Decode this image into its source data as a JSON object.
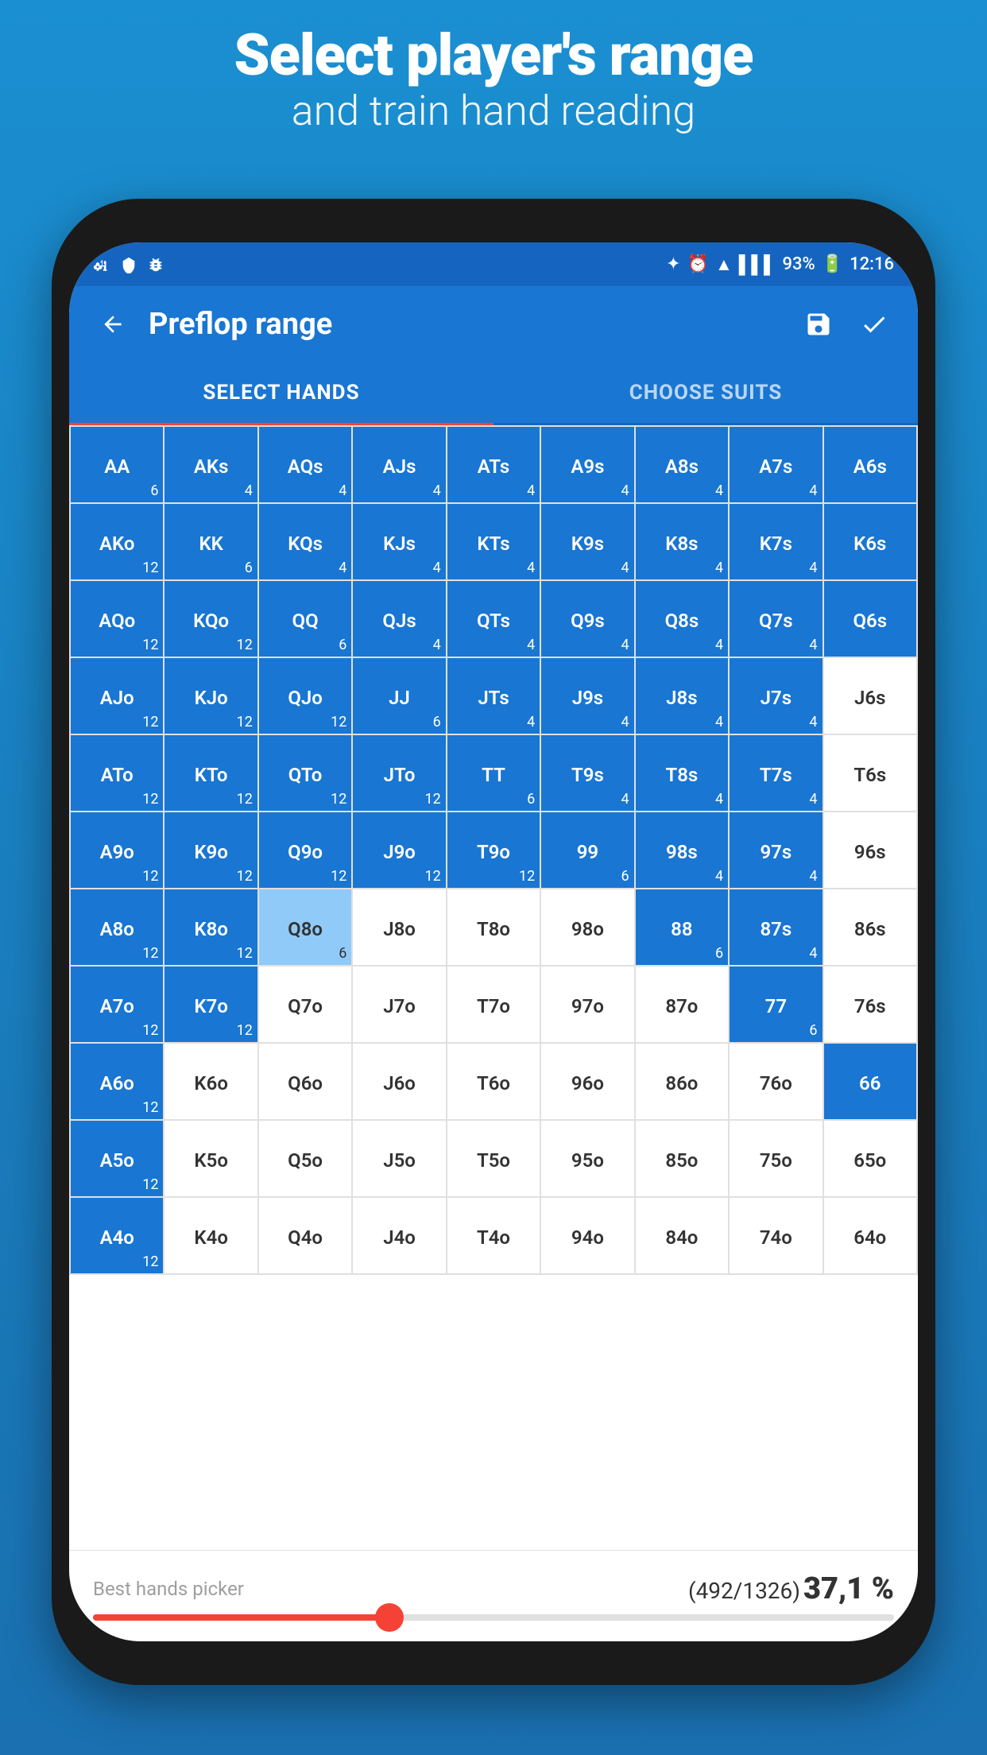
{
  "header": {
    "title": "Select player's range",
    "subtitle": "and train hand reading"
  },
  "status_bar": {
    "battery": "93%",
    "time": "12:16",
    "icons_left": [
      "usb",
      "under-armour",
      "bug"
    ],
    "icons_right": [
      "bluetooth",
      "alarm",
      "wifi",
      "signal",
      "battery",
      "time"
    ]
  },
  "app_bar": {
    "title": "Preflop range",
    "back_label": "←",
    "save_label": "💾",
    "check_label": "✓"
  },
  "tabs": [
    {
      "id": "select-hands",
      "label": "SELECT HANDS",
      "active": true
    },
    {
      "id": "choose-suits",
      "label": "CHOOSE SUITS",
      "active": false
    }
  ],
  "grid": {
    "rows": [
      [
        {
          "name": "AA",
          "count": "6",
          "style": "blue"
        },
        {
          "name": "AKs",
          "count": "4",
          "style": "blue"
        },
        {
          "name": "AQs",
          "count": "4",
          "style": "blue"
        },
        {
          "name": "AJs",
          "count": "4",
          "style": "blue"
        },
        {
          "name": "ATs",
          "count": "4",
          "style": "blue"
        },
        {
          "name": "A9s",
          "count": "4",
          "style": "blue"
        },
        {
          "name": "A8s",
          "count": "4",
          "style": "blue"
        },
        {
          "name": "A7s",
          "count": "4",
          "style": "blue"
        },
        {
          "name": "A6s",
          "count": "",
          "style": "blue"
        }
      ],
      [
        {
          "name": "AKo",
          "count": "12",
          "style": "blue"
        },
        {
          "name": "KK",
          "count": "6",
          "style": "blue"
        },
        {
          "name": "KQs",
          "count": "4",
          "style": "blue"
        },
        {
          "name": "KJs",
          "count": "4",
          "style": "blue"
        },
        {
          "name": "KTs",
          "count": "4",
          "style": "blue"
        },
        {
          "name": "K9s",
          "count": "4",
          "style": "blue"
        },
        {
          "name": "K8s",
          "count": "4",
          "style": "blue"
        },
        {
          "name": "K7s",
          "count": "4",
          "style": "blue"
        },
        {
          "name": "K6s",
          "count": "",
          "style": "blue"
        }
      ],
      [
        {
          "name": "AQo",
          "count": "12",
          "style": "blue"
        },
        {
          "name": "KQo",
          "count": "12",
          "style": "blue"
        },
        {
          "name": "QQ",
          "count": "6",
          "style": "blue"
        },
        {
          "name": "QJs",
          "count": "4",
          "style": "blue"
        },
        {
          "name": "QTs",
          "count": "4",
          "style": "blue"
        },
        {
          "name": "Q9s",
          "count": "4",
          "style": "blue"
        },
        {
          "name": "Q8s",
          "count": "4",
          "style": "blue"
        },
        {
          "name": "Q7s",
          "count": "4",
          "style": "blue"
        },
        {
          "name": "Q6s",
          "count": "",
          "style": "blue"
        }
      ],
      [
        {
          "name": "AJo",
          "count": "12",
          "style": "blue"
        },
        {
          "name": "KJo",
          "count": "12",
          "style": "blue"
        },
        {
          "name": "QJo",
          "count": "12",
          "style": "blue"
        },
        {
          "name": "JJ",
          "count": "6",
          "style": "blue"
        },
        {
          "name": "JTs",
          "count": "4",
          "style": "blue"
        },
        {
          "name": "J9s",
          "count": "4",
          "style": "blue"
        },
        {
          "name": "J8s",
          "count": "4",
          "style": "blue"
        },
        {
          "name": "J7s",
          "count": "4",
          "style": "blue"
        },
        {
          "name": "J6s",
          "count": "",
          "style": "white"
        }
      ],
      [
        {
          "name": "ATo",
          "count": "12",
          "style": "blue"
        },
        {
          "name": "KTo",
          "count": "12",
          "style": "blue"
        },
        {
          "name": "QTo",
          "count": "12",
          "style": "blue"
        },
        {
          "name": "JTo",
          "count": "12",
          "style": "blue"
        },
        {
          "name": "TT",
          "count": "6",
          "style": "blue"
        },
        {
          "name": "T9s",
          "count": "4",
          "style": "blue"
        },
        {
          "name": "T8s",
          "count": "4",
          "style": "blue"
        },
        {
          "name": "T7s",
          "count": "4",
          "style": "blue"
        },
        {
          "name": "T6s",
          "count": "",
          "style": "white"
        }
      ],
      [
        {
          "name": "A9o",
          "count": "12",
          "style": "blue"
        },
        {
          "name": "K9o",
          "count": "12",
          "style": "blue"
        },
        {
          "name": "Q9o",
          "count": "12",
          "style": "blue"
        },
        {
          "name": "J9o",
          "count": "12",
          "style": "blue"
        },
        {
          "name": "T9o",
          "count": "12",
          "style": "blue"
        },
        {
          "name": "99",
          "count": "6",
          "style": "blue"
        },
        {
          "name": "98s",
          "count": "4",
          "style": "blue"
        },
        {
          "name": "97s",
          "count": "4",
          "style": "blue"
        },
        {
          "name": "96s",
          "count": "",
          "style": "white"
        }
      ],
      [
        {
          "name": "A8o",
          "count": "12",
          "style": "blue"
        },
        {
          "name": "K8o",
          "count": "12",
          "style": "blue"
        },
        {
          "name": "Q8o",
          "count": "6",
          "style": "light-blue"
        },
        {
          "name": "J8o",
          "count": "",
          "style": "white"
        },
        {
          "name": "T8o",
          "count": "",
          "style": "white"
        },
        {
          "name": "98o",
          "count": "",
          "style": "white"
        },
        {
          "name": "88",
          "count": "6",
          "style": "blue"
        },
        {
          "name": "87s",
          "count": "4",
          "style": "blue"
        },
        {
          "name": "86s",
          "count": "",
          "style": "white"
        }
      ],
      [
        {
          "name": "A7o",
          "count": "12",
          "style": "blue"
        },
        {
          "name": "K7o",
          "count": "12",
          "style": "blue"
        },
        {
          "name": "Q7o",
          "count": "",
          "style": "white"
        },
        {
          "name": "J7o",
          "count": "",
          "style": "white"
        },
        {
          "name": "T7o",
          "count": "",
          "style": "white"
        },
        {
          "name": "97o",
          "count": "",
          "style": "white"
        },
        {
          "name": "87o",
          "count": "",
          "style": "white"
        },
        {
          "name": "77",
          "count": "6",
          "style": "blue"
        },
        {
          "name": "76s",
          "count": "",
          "style": "white"
        }
      ],
      [
        {
          "name": "A6o",
          "count": "12",
          "style": "blue"
        },
        {
          "name": "K6o",
          "count": "",
          "style": "white"
        },
        {
          "name": "Q6o",
          "count": "",
          "style": "white"
        },
        {
          "name": "J6o",
          "count": "",
          "style": "white"
        },
        {
          "name": "T6o",
          "count": "",
          "style": "white"
        },
        {
          "name": "96o",
          "count": "",
          "style": "white"
        },
        {
          "name": "86o",
          "count": "",
          "style": "white"
        },
        {
          "name": "76o",
          "count": "",
          "style": "white"
        },
        {
          "name": "66",
          "count": "",
          "style": "blue"
        }
      ],
      [
        {
          "name": "A5o",
          "count": "12",
          "style": "blue"
        },
        {
          "name": "K5o",
          "count": "",
          "style": "white"
        },
        {
          "name": "Q5o",
          "count": "",
          "style": "white"
        },
        {
          "name": "J5o",
          "count": "",
          "style": "white"
        },
        {
          "name": "T5o",
          "count": "",
          "style": "white"
        },
        {
          "name": "95o",
          "count": "",
          "style": "white"
        },
        {
          "name": "85o",
          "count": "",
          "style": "white"
        },
        {
          "name": "75o",
          "count": "",
          "style": "white"
        },
        {
          "name": "65o",
          "count": "",
          "style": "white"
        }
      ],
      [
        {
          "name": "A4o",
          "count": "12",
          "style": "blue"
        },
        {
          "name": "K4o",
          "count": "",
          "style": "white"
        },
        {
          "name": "Q4o",
          "count": "",
          "style": "white"
        },
        {
          "name": "J4o",
          "count": "",
          "style": "white"
        },
        {
          "name": "T4o",
          "count": "",
          "style": "white"
        },
        {
          "name": "94o",
          "count": "",
          "style": "white"
        },
        {
          "name": "84o",
          "count": "",
          "style": "white"
        },
        {
          "name": "74o",
          "count": "",
          "style": "white"
        },
        {
          "name": "64o",
          "count": "",
          "style": "white"
        }
      ]
    ]
  },
  "bottom_bar": {
    "best_hands_label": "Best hands picker",
    "stats": "(492/1326)",
    "percentage": "37,1 %",
    "slider_value": 37
  },
  "colors": {
    "primary": "#1976d2",
    "accent": "#f44336",
    "bg": "#1a8fd1",
    "cell_blue": "#1976d2",
    "cell_light_blue": "#90caf9",
    "cell_white": "#ffffff"
  }
}
